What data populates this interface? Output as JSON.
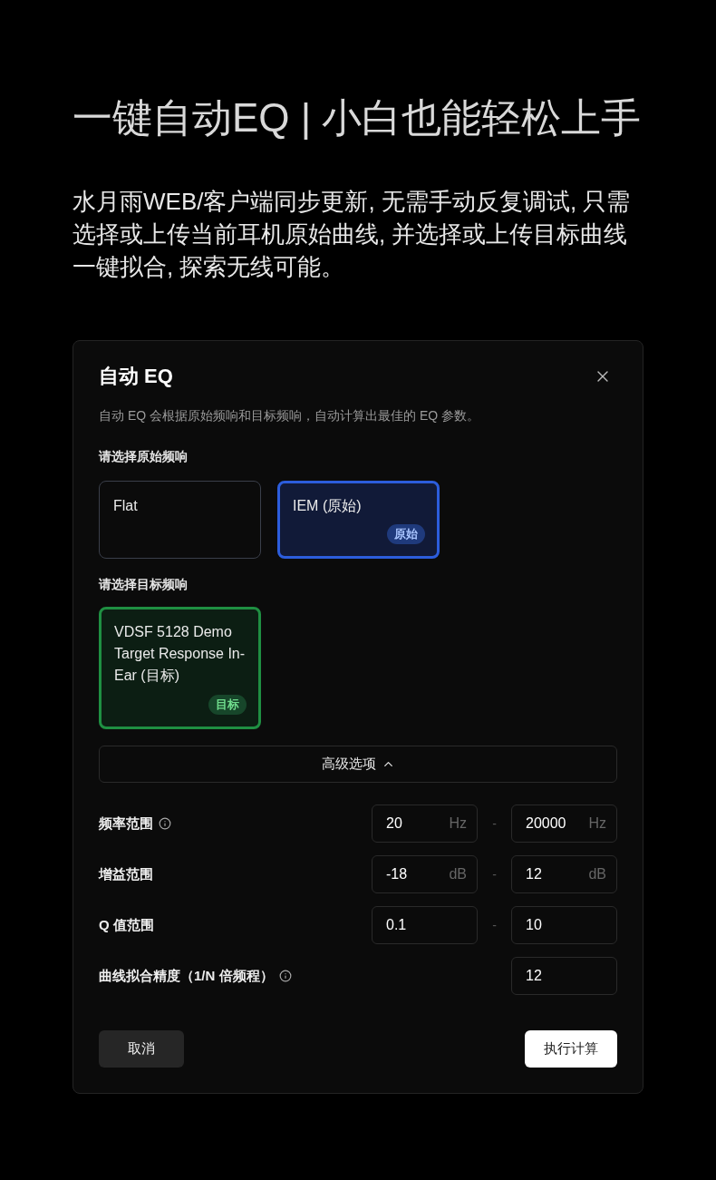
{
  "headline": "一键自动EQ | 小白也能轻松上手",
  "intro": "水月雨WEB/客户端同步更新, 无需手动反复调试, 只需选择或上传当前耳机原始曲线, 并选择或上传目标曲线一键拟合, 探索无线可能。",
  "dialog": {
    "title": "自动 EQ",
    "description": "自动 EQ 会根据原始频响和目标频响，自动计算出最佳的 EQ 参数。",
    "sections": [
      {
        "kind": "source",
        "label": "请选择原始频响",
        "options": [
          {
            "name": "Flat",
            "selected": false
          },
          {
            "name": "IEM (原始)",
            "selected": true,
            "badge": "原始"
          }
        ]
      },
      {
        "kind": "target",
        "label": "请选择目标频响",
        "options": [
          {
            "name": "VDSF 5128 Demo Target Response In-Ear (目标)",
            "selected": true,
            "badge": "目标"
          }
        ]
      }
    ],
    "advanced": {
      "label": "高级选项",
      "expanded": true
    },
    "settings": [
      {
        "kind": "range",
        "label": "频率范围",
        "info": true,
        "min": {
          "value": "20",
          "unit": "Hz"
        },
        "separator": "-",
        "max": {
          "value": "20000",
          "unit": "Hz"
        }
      },
      {
        "kind": "range",
        "label": "增益范围",
        "min": {
          "value": "-18",
          "unit": "dB"
        },
        "separator": "-",
        "max": {
          "value": "12",
          "unit": "dB"
        }
      },
      {
        "kind": "range",
        "label": "Q 值范围",
        "min": {
          "value": "0.1"
        },
        "separator": "-",
        "max": {
          "value": "10"
        }
      },
      {
        "kind": "single",
        "label": "曲线拟合精度（1/N 倍频程）",
        "info": true,
        "value": "12"
      }
    ],
    "buttons": {
      "cancel": "取消",
      "submit": "执行计算"
    }
  }
}
